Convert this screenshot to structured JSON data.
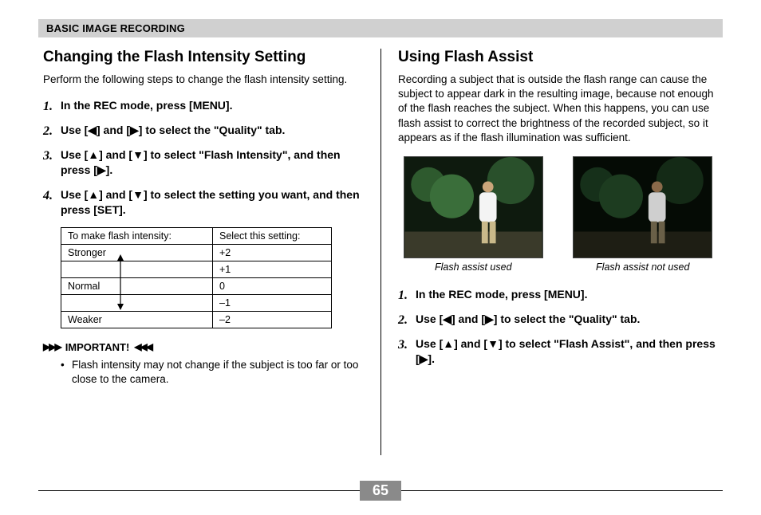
{
  "header": "BASIC IMAGE RECORDING",
  "page_number": "65",
  "left": {
    "title": "Changing the Flash Intensity Setting",
    "intro": "Perform the following steps to change the flash intensity setting.",
    "steps": [
      "In the REC mode, press [MENU].",
      "Use [◀] and [▶] to select the \"Quality\" tab.",
      "Use [▲] and [▼] to select \"Flash Intensity\", and then press [▶].",
      "Use [▲] and [▼] to select the setting you want, and then press [SET]."
    ],
    "table": {
      "headers": [
        "To make flash intensity:",
        "Select this setting:"
      ],
      "rows": [
        {
          "label": "Stronger",
          "value": "+2"
        },
        {
          "label": "",
          "value": "+1"
        },
        {
          "label": "Normal",
          "value": " 0"
        },
        {
          "label": "",
          "value": "–1"
        },
        {
          "label": "Weaker",
          "value": "–2"
        }
      ]
    },
    "important_label": "IMPORTANT!",
    "important_text": "Flash intensity may not change if the subject is too far or too close to the camera."
  },
  "right": {
    "title": "Using Flash Assist",
    "intro": "Recording a subject that is outside the flash range can cause the subject to appear dark in the resulting image, because not enough of the flash reaches the subject. When this happens, you can use flash assist to correct the brightness of the recorded subject, so it appears as if the flash illumination was sufficient.",
    "figures": [
      {
        "caption": "Flash assist used"
      },
      {
        "caption": "Flash assist not used"
      }
    ],
    "steps": [
      "In the REC mode, press [MENU].",
      "Use [◀] and [▶] to select the \"Quality\" tab.",
      "Use [▲] and [▼] to select \"Flash Assist\", and then press [▶]."
    ]
  }
}
